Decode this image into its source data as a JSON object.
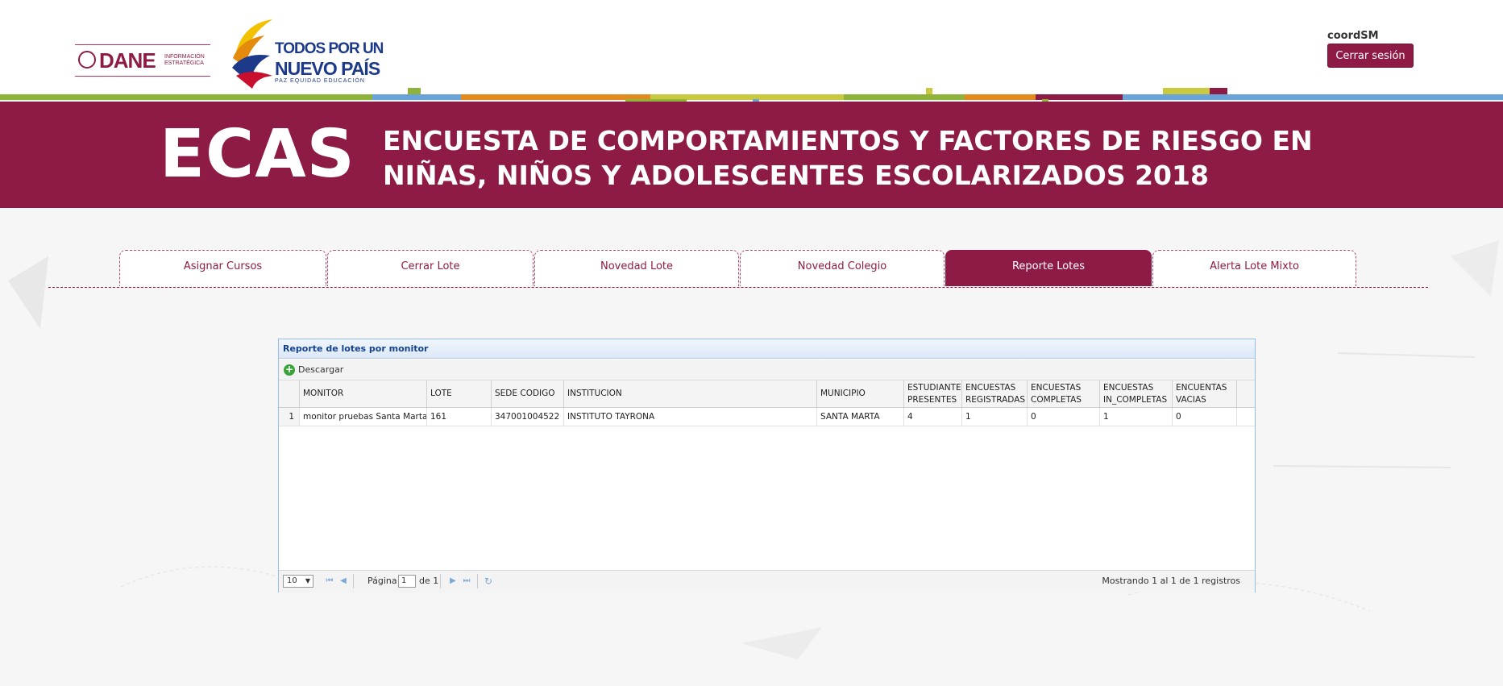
{
  "header": {
    "dane_logo_text": "DANE",
    "dane_logo_sub": "INFORMACIÓN ESTRATÉGICA",
    "gov_logo_line1": "TODOS POR UN",
    "gov_logo_line2": "NUEVO PAÍS",
    "gov_logo_sub": "PAZ   EQUIDAD   EDUCACIÓN",
    "username": "coordSM",
    "logout_label": "Cerrar sesión"
  },
  "banner": {
    "acronym": "ECAS",
    "title_line1": "ENCUESTA DE COMPORTAMIENTOS Y FACTORES DE RIESGO EN",
    "title_line2": "NIÑAS, NIÑOS Y ADOLESCENTES ESCOLARIZADOS 2018"
  },
  "tabs": [
    {
      "label": "Asignar Cursos",
      "active": false
    },
    {
      "label": "Cerrar Lote",
      "active": false
    },
    {
      "label": "Novedad  Lote",
      "active": false
    },
    {
      "label": "Novedad Colegio",
      "active": false
    },
    {
      "label": "Reporte Lotes",
      "active": true
    },
    {
      "label": "Alerta Lote Mixto",
      "active": false
    }
  ],
  "grid": {
    "caption": "Reporte de lotes por monitor",
    "download_label": "Descargar",
    "columns": [
      {
        "line1": "MONITOR",
        "line2": ""
      },
      {
        "line1": "LOTE",
        "line2": ""
      },
      {
        "line1": "SEDE CODIGO",
        "line2": ""
      },
      {
        "line1": "INSTITUCION",
        "line2": ""
      },
      {
        "line1": "MUNICIPIO",
        "line2": ""
      },
      {
        "line1": "ESTUDIANTES",
        "line2": "PRESENTES"
      },
      {
        "line1": "ENCUESTAS",
        "line2": "REGISTRADAS"
      },
      {
        "line1": "ENCUESTAS",
        "line2": "COMPLETAS"
      },
      {
        "line1": "ENCUESTAS",
        "line2": "IN_COMPLETAS"
      },
      {
        "line1": "ENCUENTAS",
        "line2": "VACIAS"
      }
    ],
    "rows": [
      {
        "n": "1",
        "cells": [
          "monitor pruebas Santa Marta",
          "161",
          "347001004522",
          "INSTITUTO TAYRONA",
          "SANTA MARTA",
          "4",
          "1",
          "0",
          "1",
          "0"
        ]
      }
    ]
  },
  "pager": {
    "page_size": "10",
    "page_label": "Página",
    "page_value": "1",
    "of_label": "de 1",
    "info": "Mostrando 1 al 1 de 1 registros"
  },
  "colors": {
    "brand": "#8e1b46",
    "grid_border": "#99bbe8",
    "caption_text": "#15428b"
  }
}
